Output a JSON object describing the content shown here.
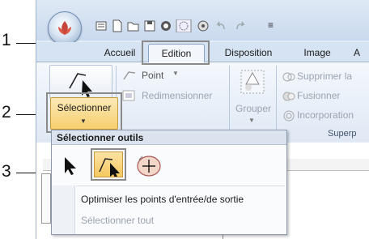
{
  "tabs": [
    "Accueil",
    "Edition",
    "Disposition",
    "Image",
    "A"
  ],
  "ribbon": {
    "point_label": "Point",
    "redimensionner_label": "Redimensionner",
    "grouper_label": "Grouper",
    "supprimer_label": "Supprimer la",
    "fusionner_label": "Fusionner",
    "incorporation_label": "Incorporation",
    "group_label_partial": "er",
    "group_label_superp": "Superp"
  },
  "select_button_label": "Sélectionner",
  "dropdown": {
    "header": "Sélectionner outils",
    "item_optimize": "Optimiser les points d'entrée/de sortie",
    "item_select_all": "Sélectionner tout"
  },
  "callouts": [
    "1",
    "2",
    "3"
  ],
  "colors": {
    "highlight": "#f6cf6e",
    "frame": "#8a8a8a",
    "ribbon_bg": "#dfe8f4"
  },
  "icons": [
    "app-logo-icon",
    "new-icon",
    "open-icon",
    "save-icon",
    "record-icon",
    "undo-icon",
    "redo-icon"
  ]
}
